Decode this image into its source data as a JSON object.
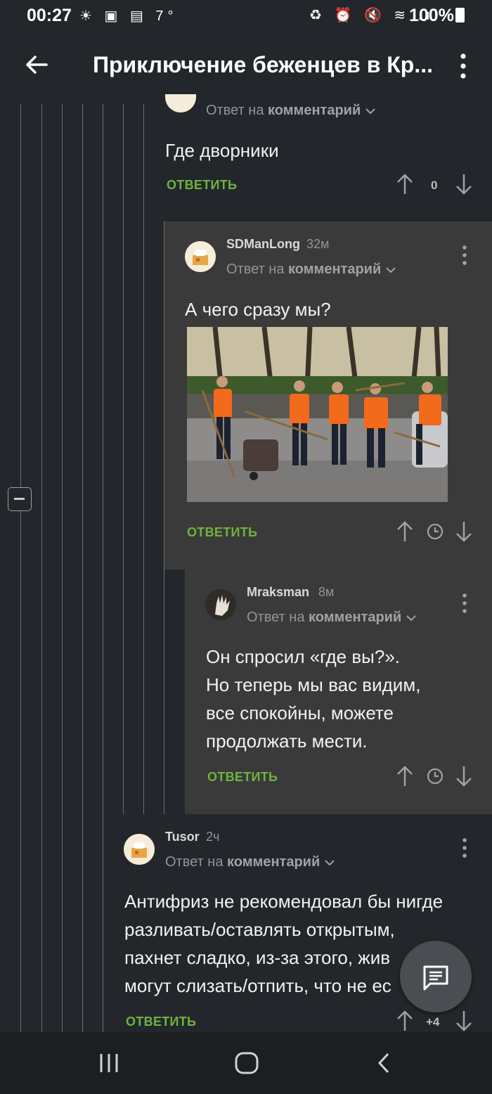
{
  "status_bar": {
    "time": "00:27",
    "left_icons": "☀ ▣ ▤ 7°",
    "right_icons": "♻ ⏰ 🔇 ≋ .ıl",
    "battery": "100%"
  },
  "header": {
    "title": "Приключение беженцев  в Кр...",
    "back_icon": "back-arrow-icon",
    "menu_icon": "more-vert-icon"
  },
  "comments": [
    {
      "reply_prefix": "Ответ на",
      "reply_target": "комментарий",
      "text": "Где дворники",
      "reply_label": "ОТВЕТИТЬ",
      "score": "0"
    },
    {
      "username": "SDManLong",
      "time": "32м",
      "reply_prefix": "Ответ на",
      "reply_target": "комментарий",
      "text": "А чего сразу мы?",
      "has_image": true,
      "reply_label": "ОТВЕТИТЬ",
      "score_icon": "clock-icon"
    },
    {
      "username": "Mraksman",
      "time": "8м",
      "reply_prefix": "Ответ на",
      "reply_target": "комментарий",
      "lines": [
        "Он спросил «где вы?».",
        "Но теперь мы вас видим,",
        "все спокойны, можете",
        "продолжать мести."
      ],
      "reply_label": "ОТВЕТИТЬ",
      "score_icon": "clock-icon"
    },
    {
      "username": "Tusor",
      "time": "2ч",
      "reply_prefix": "Ответ на",
      "reply_target": "комментарий",
      "lines": [
        "Антифриз не рекомендовал бы нигде",
        "разливать/оставлять открытым,",
        "пахнет сладко, из-за этого, жив",
        "могут слизать/отпить, что не ес"
      ],
      "reply_label": "ОТВЕТИТЬ",
      "score": "+4"
    }
  ],
  "colors": {
    "background": "#23272b",
    "highlight_block": "#3a3a3a",
    "reply_green": "#6db33f",
    "vest_orange": "#f26a1b"
  }
}
